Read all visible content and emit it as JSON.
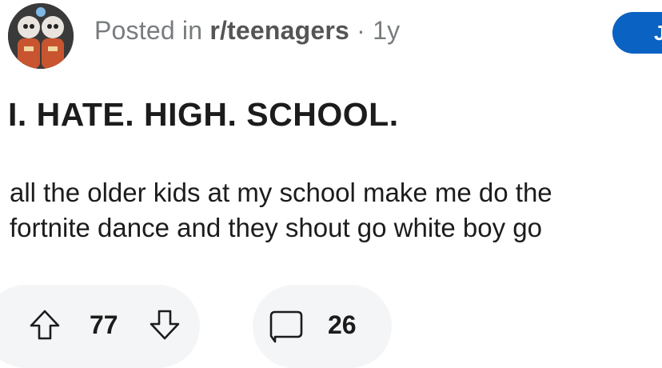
{
  "post": {
    "meta_prefix": "Posted in ",
    "subreddit": "r/teenagers",
    "age": " · 1y",
    "join_label": "J",
    "title": "I. HATE. HIGH. SCHOOL.",
    "body_line1": "all the older kids at my school make me do the",
    "body_line2": "fortnite dance and they shout go white boy go"
  },
  "actions": {
    "upvotes": "77",
    "comments": "26"
  },
  "colors": {
    "join_button": "#0a62c2",
    "meta_text": "#787c7e",
    "pill_background": "#f4f5f6"
  },
  "icons": {
    "upvote": "upvote-arrow-icon",
    "downvote": "downvote-arrow-icon",
    "comment": "comment-bubble-icon"
  }
}
